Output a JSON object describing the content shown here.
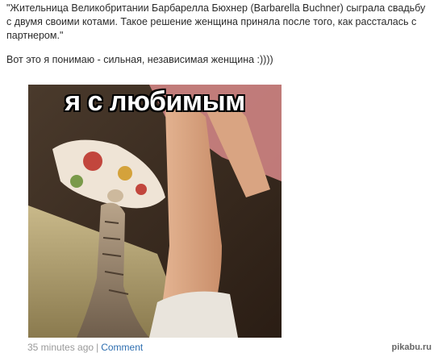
{
  "post": {
    "paragraphs": [
      "\"Жительница Великобритании Барбарелла Бюхнер (Barbarella Buchner) сыграла свадьбу с двумя своими котами. Такое решение женщина приняла после того, как рассталась с партнером.\"",
      "Вот это я понимаю - сильная, независимая женщина :))))"
    ]
  },
  "image": {
    "caption": "я с любимым"
  },
  "meta": {
    "time": "35 minutes ago",
    "separator": "|",
    "comment_label": "Comment"
  },
  "watermark": {
    "text": "pikabu.ru"
  },
  "colors": {
    "link": "#2f6fb0",
    "meta": "#999999"
  }
}
